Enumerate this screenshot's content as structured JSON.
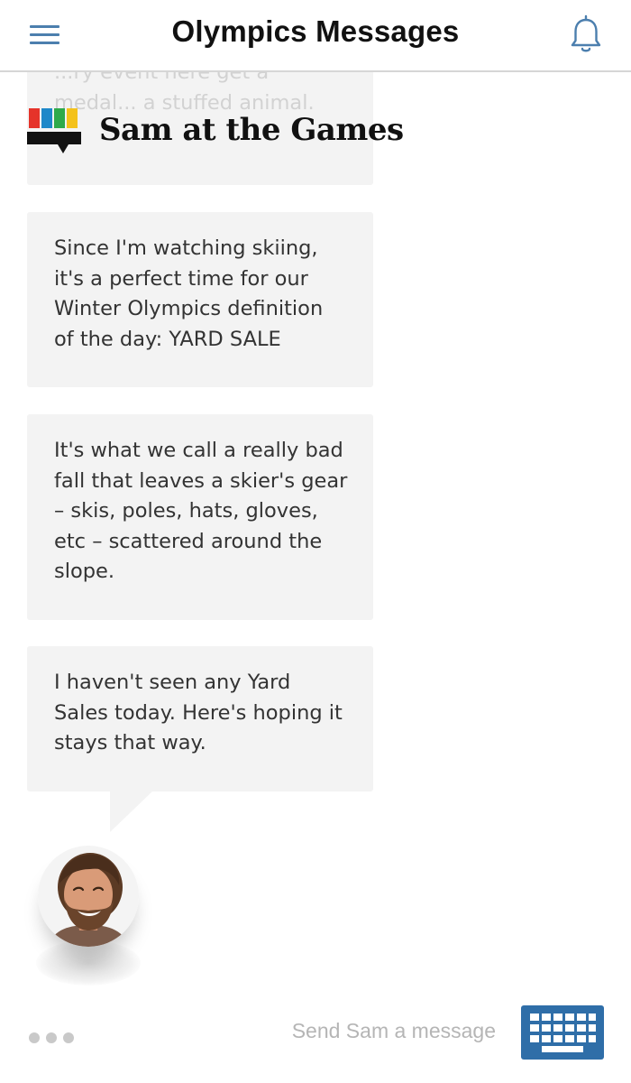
{
  "header": {
    "title": "Olympics Messages",
    "menu_icon": "hamburger-menu-icon",
    "bell_icon": "bell-icon"
  },
  "brand": {
    "title": "Sam at the Games",
    "logo_colors": [
      "#e5332a",
      "#1e88c9",
      "#2eaa4a",
      "#f4c21b"
    ]
  },
  "messages": [
    {
      "text": "...ry event here get a medal... a stuffed animal.",
      "faded": true
    },
    {
      "text": "Since I'm watching skiing, it's a perfect time for our Winter Olympics definition of the day: YARD SALE"
    },
    {
      "text": "It's what we call a really bad fall that leaves a skier's gear – skis, poles, hats, gloves, etc – scattered around the slope."
    },
    {
      "text": "I haven't seen any Yard Sales today. Here's hoping it stays that way."
    }
  ],
  "composer": {
    "placeholder": "Send Sam a message",
    "more_icon": "more-dots-icon",
    "keyboard_icon": "keyboard-icon"
  },
  "colors": {
    "accent": "#2f6ea8",
    "bubble": "#f3f3f3",
    "text": "#333333"
  }
}
